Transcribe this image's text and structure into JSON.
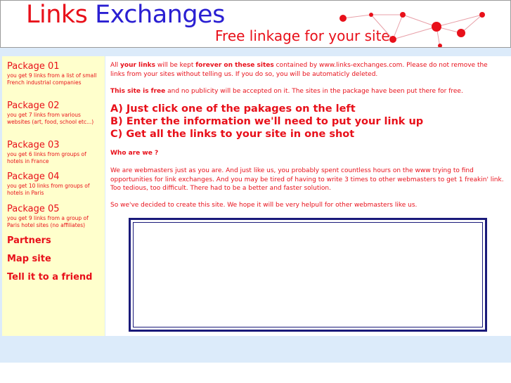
{
  "header": {
    "logo_word1": "Links",
    "logo_word2": "Exchanges",
    "tagline": "Free linkage for your site"
  },
  "sidebar": {
    "packages": [
      {
        "title": "Package 01",
        "desc": "you get 9 links from a list of small French industrial companies"
      },
      {
        "title": "Package 02",
        "desc": "you get 7 links from various websites (art, food, school etc...)"
      },
      {
        "title": "Package 03",
        "desc": "you get 6 links from groups of hotels in France"
      },
      {
        "title": "Package 04",
        "desc": "you get 10 links from groups of hotels in Paris"
      },
      {
        "title": "Package 05",
        "desc": "you get 9 links from a group of Paris hotel sites (no affiliates)"
      }
    ],
    "links": [
      "Partners",
      "Map site",
      "Tell it to a friend"
    ]
  },
  "main": {
    "para1": {
      "a": "All ",
      "b": "your links",
      "c": " will be kept ",
      "d": "forever on these sites",
      "e": " contained by www.links-exchanges.com. Please do not remove the links from your sites without telling us. If you do so, you will be automaticly deleted."
    },
    "para2": {
      "b": "This site is free",
      "rest": " and no publicity will be accepted on it. The sites in the package have been put there for free."
    },
    "steps": [
      "A) Just click one of the pakages on the left",
      "B) Enter the information we'll need to put your link up",
      "C) Get all the links to your site in one shot"
    ],
    "who_heading": "Who are we ?",
    "para3": "We are webmasters just as you are. And just like us, you probably spent countless hours on the www trying to find opportunities for link exchanges. And you may be tired of having to write 3 times to other webmasters to get 1 freakin' link. Too tedious, too difficult. There had to be a better and faster solution.",
    "para4": "So we've decided to create this site. We hope it will be very helpull for other webmasters like us."
  },
  "colors": {
    "accent_red": "#e8101a",
    "logo_blue": "#2a1fd2",
    "sidebar_bg": "#ffffcc",
    "page_bg": "#dcebfa",
    "frame_border": "#1a1a7a"
  }
}
